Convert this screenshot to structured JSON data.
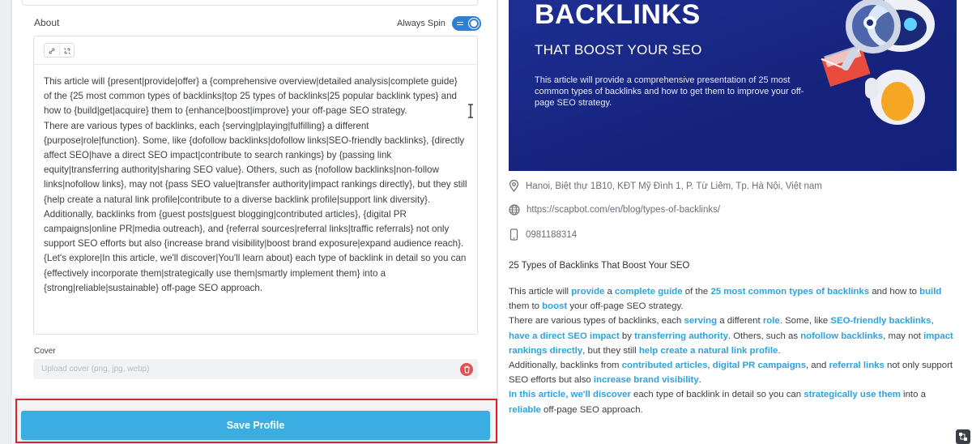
{
  "profile_form": {
    "about_label": "About",
    "always_spin_label": "Always Spin",
    "always_spin_on": true,
    "editor_paragraphs": [
      "This article will {present|provide|offer} a {comprehensive overview|detailed analysis|complete guide} of the {25 most common types of backlinks|top 25 types of backlinks|25 popular backlink types} and how to {build|get|acquire} them to {enhance|boost|improve} your off-page SEO strategy.",
      "There are various types of backlinks, each {serving|playing|fulfilling} a different {purpose|role|function}. Some, like {dofollow backlinks|dofollow links|SEO-friendly backlinks}, {directly affect SEO|have a direct SEO impact|contribute to search rankings} by {passing link equity|transferring authority|sharing SEO value}. Others, such as {nofollow backlinks|non-follow links|nofollow links}, may not {pass SEO value|transfer authority|impact rankings directly}, but they still {help create a natural link profile|contribute to a diverse backlink profile|support link diversity}.",
      "Additionally, backlinks from {guest posts|guest blogging|contributed articles}, {digital PR campaigns|online PR|media outreach}, and {referral sources|referral links|traffic referrals} not only support SEO efforts but also {increase brand visibility|boost brand exposure|expand audience reach}.",
      "{Let's explore|In this article, we'll discover|You'll learn about} each type of backlink in detail so you can {effectively incorporate them|strategically use them|smartly implement them} into a {strong|reliable|sustainable} off-page SEO approach."
    ],
    "cover_label": "Cover",
    "cover_placeholder": "Upload cover (png, jpg, webp)",
    "save_button": "Save Profile"
  },
  "preview": {
    "hero_title": "BACKLINKS",
    "hero_subtitle": "THAT BOOST YOUR SEO",
    "hero_description": "This article will provide a comprehensive presentation of 25 most common types of backlinks and how to get them to improve your off-page SEO strategy.",
    "address": "Hanoi, Biệt thự 1B10, KĐT Mỹ Đình 1, P. Từ Liêm, Tp. Hà Nội, Việt nam",
    "url": "https://scapbot.com/en/blog/types-of-backlinks/",
    "phone": "0981188314",
    "article_title": "25 Types of Backlinks That Boost Your SEO",
    "paragraphs": [
      [
        {
          "t": "This article will "
        },
        {
          "t": "provide",
          "h": true
        },
        {
          "t": " a "
        },
        {
          "t": "complete guide",
          "h": true
        },
        {
          "t": " of the "
        },
        {
          "t": "25 most common types of backlinks",
          "h": true
        },
        {
          "t": " and how to "
        },
        {
          "t": "build",
          "h": true
        },
        {
          "t": " them to "
        },
        {
          "t": "boost",
          "h": true
        },
        {
          "t": " your off-page SEO strategy."
        }
      ],
      [
        {
          "t": "There are various types of backlinks, each "
        },
        {
          "t": "serving",
          "h": true
        },
        {
          "t": " a different "
        },
        {
          "t": "role",
          "h": true
        },
        {
          "t": ". Some, like "
        },
        {
          "t": "SEO-friendly backlinks",
          "h": true
        },
        {
          "t": ", "
        },
        {
          "t": "have a direct SEO impact",
          "h": true
        },
        {
          "t": " by "
        },
        {
          "t": "transferring authority",
          "h": true
        },
        {
          "t": ". Others, such as "
        },
        {
          "t": "nofollow backlinks",
          "h": true
        },
        {
          "t": ", may not "
        },
        {
          "t": "impact rankings directly",
          "h": true
        },
        {
          "t": ", but they still "
        },
        {
          "t": "help create a natural link profile",
          "h": true
        },
        {
          "t": "."
        }
      ],
      [
        {
          "t": "Additionally, backlinks from "
        },
        {
          "t": "contributed articles",
          "h": true
        },
        {
          "t": ", "
        },
        {
          "t": "digital PR campaigns",
          "h": true
        },
        {
          "t": ", and "
        },
        {
          "t": "referral links",
          "h": true
        },
        {
          "t": " not only support SEO efforts but also "
        },
        {
          "t": "increase brand visibility",
          "h": true
        },
        {
          "t": "."
        }
      ],
      [
        {
          "t": "In this article, we'll discover",
          "h": true
        },
        {
          "t": " each type of backlink in detail so you can "
        },
        {
          "t": "strategically use them",
          "h": true
        },
        {
          "t": " into a "
        },
        {
          "t": "reliable",
          "h": true
        },
        {
          "t": " off-page SEO approach."
        }
      ]
    ]
  },
  "colors": {
    "accent": "#3aaee3",
    "highlight": "#2ea2dc",
    "hero_bg": "#1a2a8c",
    "save_outline": "#d8232a",
    "toggle": "#2f80d1",
    "delete": "#e35050"
  },
  "icons": {
    "address": "map-pin-icon",
    "url": "globe-icon",
    "phone": "phone-icon",
    "toolbar": [
      "link-icon",
      "unlink-icon"
    ],
    "cover": "trash-icon"
  }
}
